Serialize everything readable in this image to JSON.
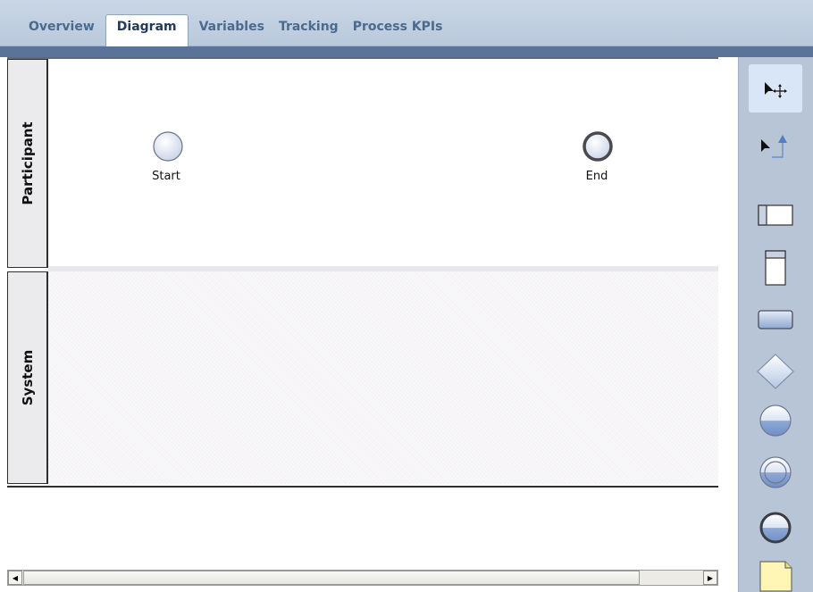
{
  "tabs": [
    {
      "label": "Overview",
      "active": false
    },
    {
      "label": "Diagram",
      "active": true
    },
    {
      "label": "Variables",
      "active": false
    },
    {
      "label": "Tracking",
      "active": false
    },
    {
      "label": "Process KPIs",
      "active": false
    }
  ],
  "lanes": {
    "participant": "Participant",
    "system": "System"
  },
  "events": {
    "start_label": "Start",
    "end_label": "End"
  },
  "scrollbar": {
    "left_arrow": "◀",
    "right_arrow": "▶"
  },
  "palette": {
    "tools": [
      {
        "icon": "select-move-icon",
        "selected": true
      },
      {
        "icon": "connect-icon",
        "selected": false
      },
      {
        "icon": "horizontal-lane-icon",
        "selected": false
      },
      {
        "icon": "vertical-lane-icon",
        "selected": false
      },
      {
        "icon": "activity-icon",
        "selected": false
      },
      {
        "icon": "gateway-icon",
        "selected": false
      },
      {
        "icon": "start-event-icon",
        "selected": false
      },
      {
        "icon": "intermediate-event-icon",
        "selected": false
      },
      {
        "icon": "end-event-icon",
        "selected": false
      },
      {
        "icon": "note-icon",
        "selected": false
      }
    ]
  },
  "colors": {
    "tab_active_text": "#213a5e",
    "tab_inactive_text": "#4a6b8e",
    "tab_strip": "#c9d6e5",
    "tab_underline": "#5a7499",
    "palette_bg": "#b7c5d6",
    "palette_selected": "#d9e6f7",
    "event_fill": "#dfe5f2",
    "note_fill": "#fff6b5"
  }
}
